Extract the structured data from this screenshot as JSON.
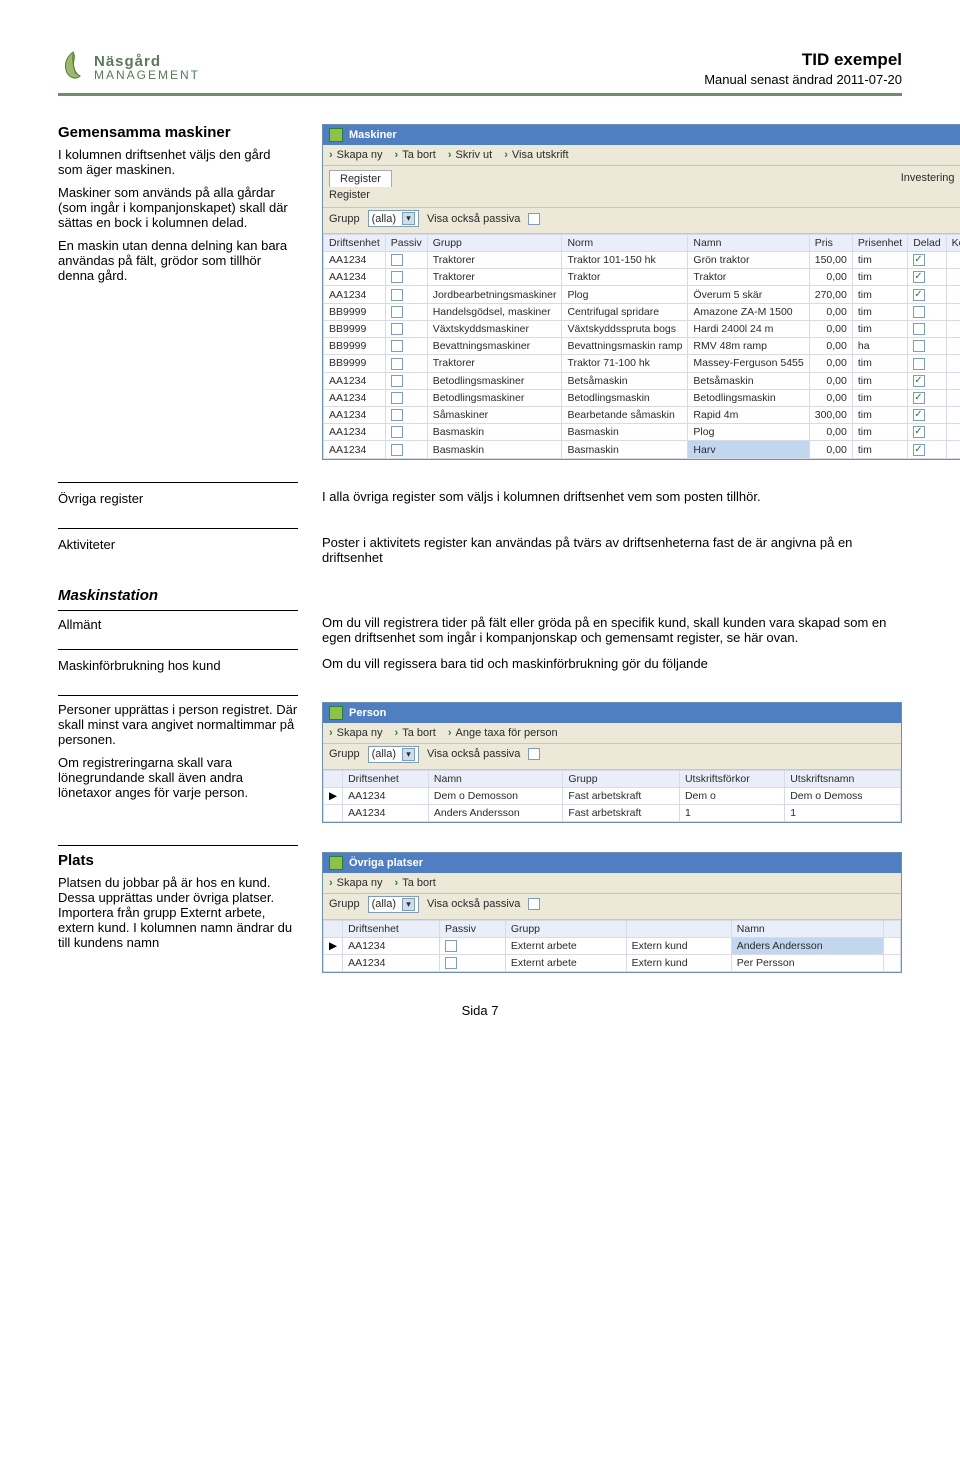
{
  "header": {
    "logo_line1": "Näsgård",
    "logo_line2": "MANAGEMENT",
    "doc_title": "TID exempel",
    "doc_date": "Manual senast ändrad 2011-07-20"
  },
  "s1": {
    "heading": "Gemensamma maskiner",
    "p1": "I kolumnen driftsenhet väljs den gård som äger maskinen.",
    "p2": "Maskiner som används på alla gårdar (som ingår i kompanjonskapet) skall där sättas en bock i kolumnen delad.",
    "p3": "En maskin utan denna delning kan bara användas på fält, grödor som tillhör denna gård."
  },
  "shot1": {
    "title": "Maskiner",
    "toolbar": [
      "Skapa ny",
      "Ta bort",
      "Skriv ut",
      "Visa utskrift"
    ],
    "tab_active": "Register",
    "tab_right": "Investering",
    "subtab": "Register",
    "grupp_label": "Grupp",
    "grupp_value": "(alla)",
    "passiva_label": "Visa också passiva",
    "columns": [
      "Driftsenhet",
      "Passiv",
      "Grupp",
      "Norm",
      "Namn",
      "Pris",
      "Prisenhet",
      "Delad",
      "Ko"
    ],
    "rows": [
      {
        "d": "AA1234",
        "g": "Traktorer",
        "n": "Traktor 101-150 hk",
        "namn": "Grön traktor",
        "pris": "150,00",
        "pe": "tim",
        "del": true
      },
      {
        "d": "AA1234",
        "g": "Traktorer",
        "n": "Traktor",
        "namn": "Traktor",
        "pris": "0,00",
        "pe": "tim",
        "del": true
      },
      {
        "d": "AA1234",
        "g": "Jordbearbetningsmaskiner",
        "n": "Plog",
        "namn": "Överum 5 skär",
        "pris": "270,00",
        "pe": "tim",
        "del": true
      },
      {
        "d": "BB9999",
        "g": "Handelsgödsel, maskiner",
        "n": "Centrifugal spridare",
        "namn": "Amazone ZA-M 1500",
        "pris": "0,00",
        "pe": "tim",
        "del": false
      },
      {
        "d": "BB9999",
        "g": "Växtskyddsmaskiner",
        "n": "Växtskyddsspruta bogs",
        "namn": "Hardi 2400l 24 m",
        "pris": "0,00",
        "pe": "tim",
        "del": false
      },
      {
        "d": "BB9999",
        "g": "Bevattningsmaskiner",
        "n": "Bevattningsmaskin ramp",
        "namn": "RMV 48m ramp",
        "pris": "0,00",
        "pe": "ha",
        "del": false
      },
      {
        "d": "BB9999",
        "g": "Traktorer",
        "n": "Traktor 71-100 hk",
        "namn": "Massey-Ferguson 5455",
        "pris": "0,00",
        "pe": "tim",
        "del": false
      },
      {
        "d": "AA1234",
        "g": "Betodlingsmaskiner",
        "n": "Betsåmaskin",
        "namn": "Betsåmaskin",
        "pris": "0,00",
        "pe": "tim",
        "del": true
      },
      {
        "d": "AA1234",
        "g": "Betodlingsmaskiner",
        "n": "Betodlingsmaskin",
        "namn": "Betodlingsmaskin",
        "pris": "0,00",
        "pe": "tim",
        "del": true
      },
      {
        "d": "AA1234",
        "g": "Såmaskiner",
        "n": "Bearbetande såmaskin",
        "namn": "Rapid 4m",
        "pris": "300,00",
        "pe": "tim",
        "del": true
      },
      {
        "d": "AA1234",
        "g": "Basmaskin",
        "n": "Basmaskin",
        "namn": "Plog",
        "pris": "0,00",
        "pe": "tim",
        "del": true
      },
      {
        "d": "AA1234",
        "g": "Basmaskin",
        "n": "Basmaskin",
        "namn": "Harv",
        "pris": "0,00",
        "pe": "tim",
        "del": true,
        "hl": true
      }
    ]
  },
  "defs": {
    "d1_label": "Övriga register",
    "d1_text": "I alla övriga register som väljs i kolumnen driftsenhet vem som posten tillhör.",
    "d2_label": "Aktiviteter",
    "d2_text": "Poster i aktivitets register kan användas på tvärs av driftsenheterna fast de är angivna på en driftsenhet",
    "d3_heading": "Maskinstation",
    "d3_label": "Allmänt",
    "d3_text": "Om du vill registrera tider på fält eller gröda på en specifik kund, skall kunden vara skapad som en egen driftsenhet som ingår i kompanjonskap och gemensamt register, se här ovan.",
    "d4_label": "Maskinförbrukning hos kund",
    "d4_text": "Om du vill regissera bara tid och maskinförbrukning gör du följande"
  },
  "s2": {
    "p1": "Personer upprättas i person registret. Där skall minst vara angivet normaltimmar på personen.",
    "p2": "Om registreringarna skall vara lönegrundande skall även andra lönetaxor anges för varje person."
  },
  "shot2": {
    "title": "Person",
    "toolbar": [
      "Skapa ny",
      "Ta bort",
      "Ange taxa för person"
    ],
    "grupp_label": "Grupp",
    "grupp_value": "(alla)",
    "passiva_label": "Visa också passiva",
    "columns": [
      "Driftsenhet",
      "Namn",
      "Grupp",
      "Utskriftsförkor",
      "Utskriftsnamn"
    ],
    "rows": [
      {
        "mark": "▶",
        "d": "AA1234",
        "n": "Dem o Demosson",
        "g": "Fast arbetskraft",
        "uf": "Dem o",
        "un": "Dem o Demoss"
      },
      {
        "mark": "",
        "d": "AA1234",
        "n": "Anders Andersson",
        "g": "Fast arbetskraft",
        "uf": "1",
        "un": "1"
      }
    ]
  },
  "s3": {
    "heading": "Plats",
    "p1": "Platsen du jobbar på är hos en kund. Dessa upprättas under övriga platser. Importera från grupp Externt arbete, extern kund. I kolumnen namn ändrar du till kundens namn"
  },
  "shot3": {
    "title": "Övriga platser",
    "toolbar": [
      "Skapa ny",
      "Ta bort"
    ],
    "grupp_label": "Grupp",
    "grupp_value": "(alla)",
    "passiva_label": "Visa också passiva",
    "columns": [
      "Driftsenhet",
      "Passiv",
      "Grupp",
      "",
      "Namn",
      ""
    ],
    "rows": [
      {
        "mark": "▶",
        "d": "AA1234",
        "g": "Externt arbete",
        "gn": "Extern kund",
        "n": "Anders Andersson",
        "hl": true
      },
      {
        "mark": "",
        "d": "AA1234",
        "g": "Externt arbete",
        "gn": "Extern kund",
        "n": "Per Persson"
      }
    ]
  },
  "footer": {
    "page": "Sida 7"
  }
}
